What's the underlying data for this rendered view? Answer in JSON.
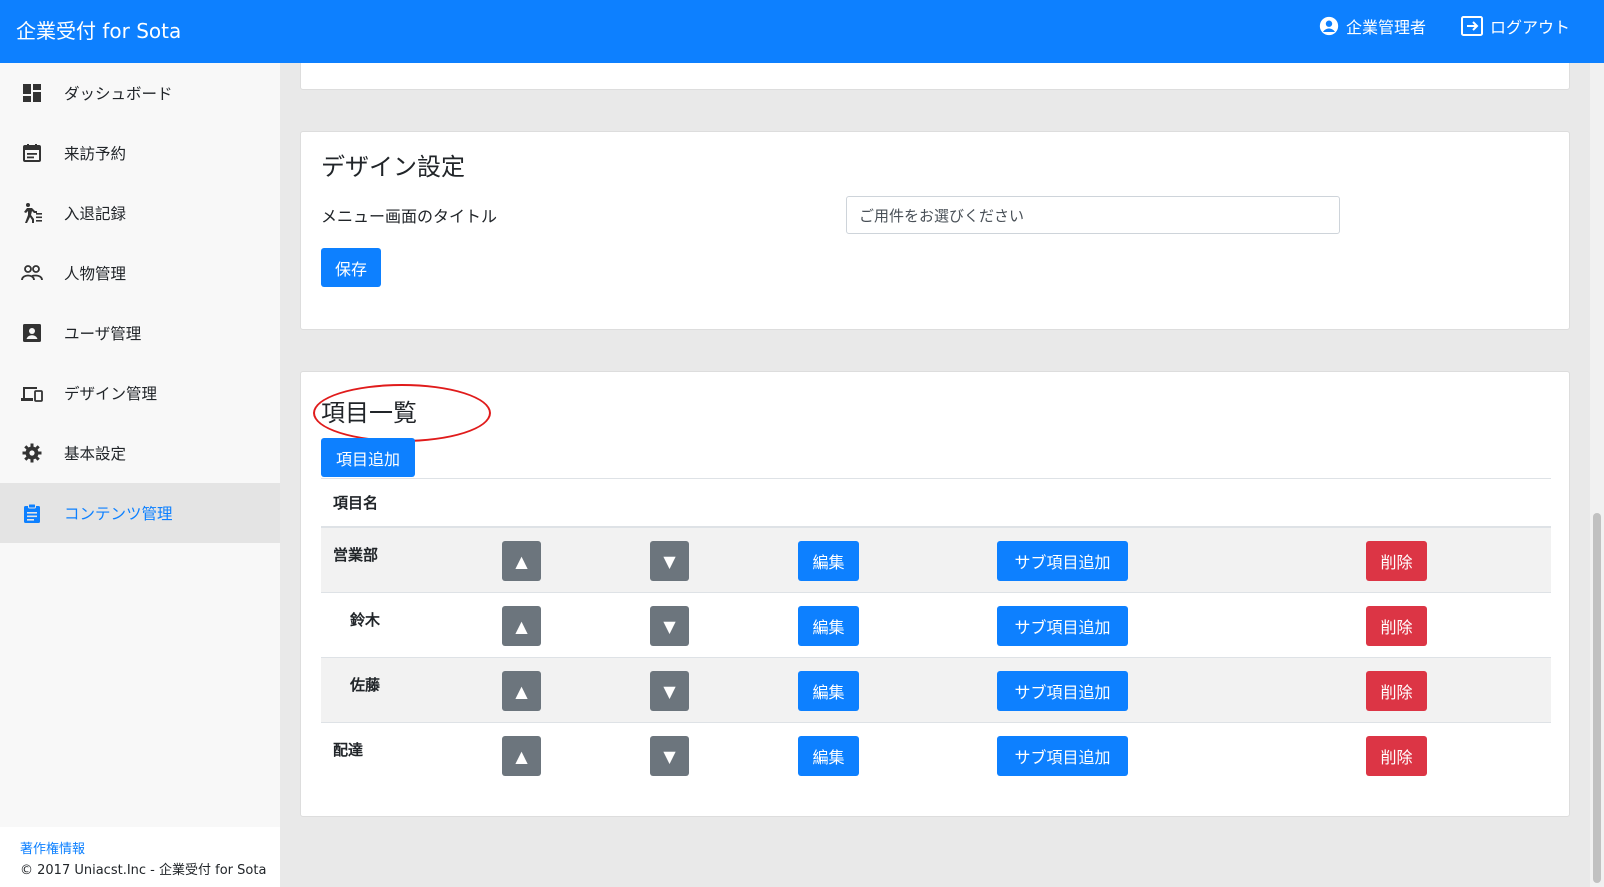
{
  "header": {
    "brand": "企業受付 for Sota",
    "user_label": "企業管理者",
    "logout_label": "ログアウト"
  },
  "sidebar": {
    "items": [
      {
        "label": "ダッシュボード",
        "icon": "dashboard-icon"
      },
      {
        "label": "来訪予約",
        "icon": "calendar-icon"
      },
      {
        "label": "入退記録",
        "icon": "walk-icon"
      },
      {
        "label": "人物管理",
        "icon": "people-icon"
      },
      {
        "label": "ユーザ管理",
        "icon": "user-card-icon"
      },
      {
        "label": "デザイン管理",
        "icon": "devices-icon"
      },
      {
        "label": "基本設定",
        "icon": "gear-icon"
      },
      {
        "label": "コンテンツ管理",
        "icon": "clipboard-icon",
        "active": true
      }
    ],
    "footer": {
      "link": "著作権情報",
      "copyright": "© 2017 Uniacst.Inc - 企業受付 for Sota"
    }
  },
  "design": {
    "title": "デザイン設定",
    "field_label": "メニュー画面のタイトル",
    "field_value": "ご用件をお選びください",
    "save_label": "保存"
  },
  "items": {
    "title": "項目一覧",
    "add_label": "項目追加",
    "col_name": "項目名",
    "btn_up": "▲",
    "btn_down": "▼",
    "btn_edit": "編集",
    "btn_add_sub": "サブ項目追加",
    "btn_delete": "削除",
    "rows": [
      {
        "name": "営業部",
        "sub": false
      },
      {
        "name": "鈴木",
        "sub": true
      },
      {
        "name": "佐藤",
        "sub": true
      },
      {
        "name": "配達",
        "sub": false
      }
    ]
  },
  "colors": {
    "primary": "#0d80ff",
    "secondary": "#6c757d",
    "danger": "#dc3545",
    "annotation": "#e01b1b"
  }
}
